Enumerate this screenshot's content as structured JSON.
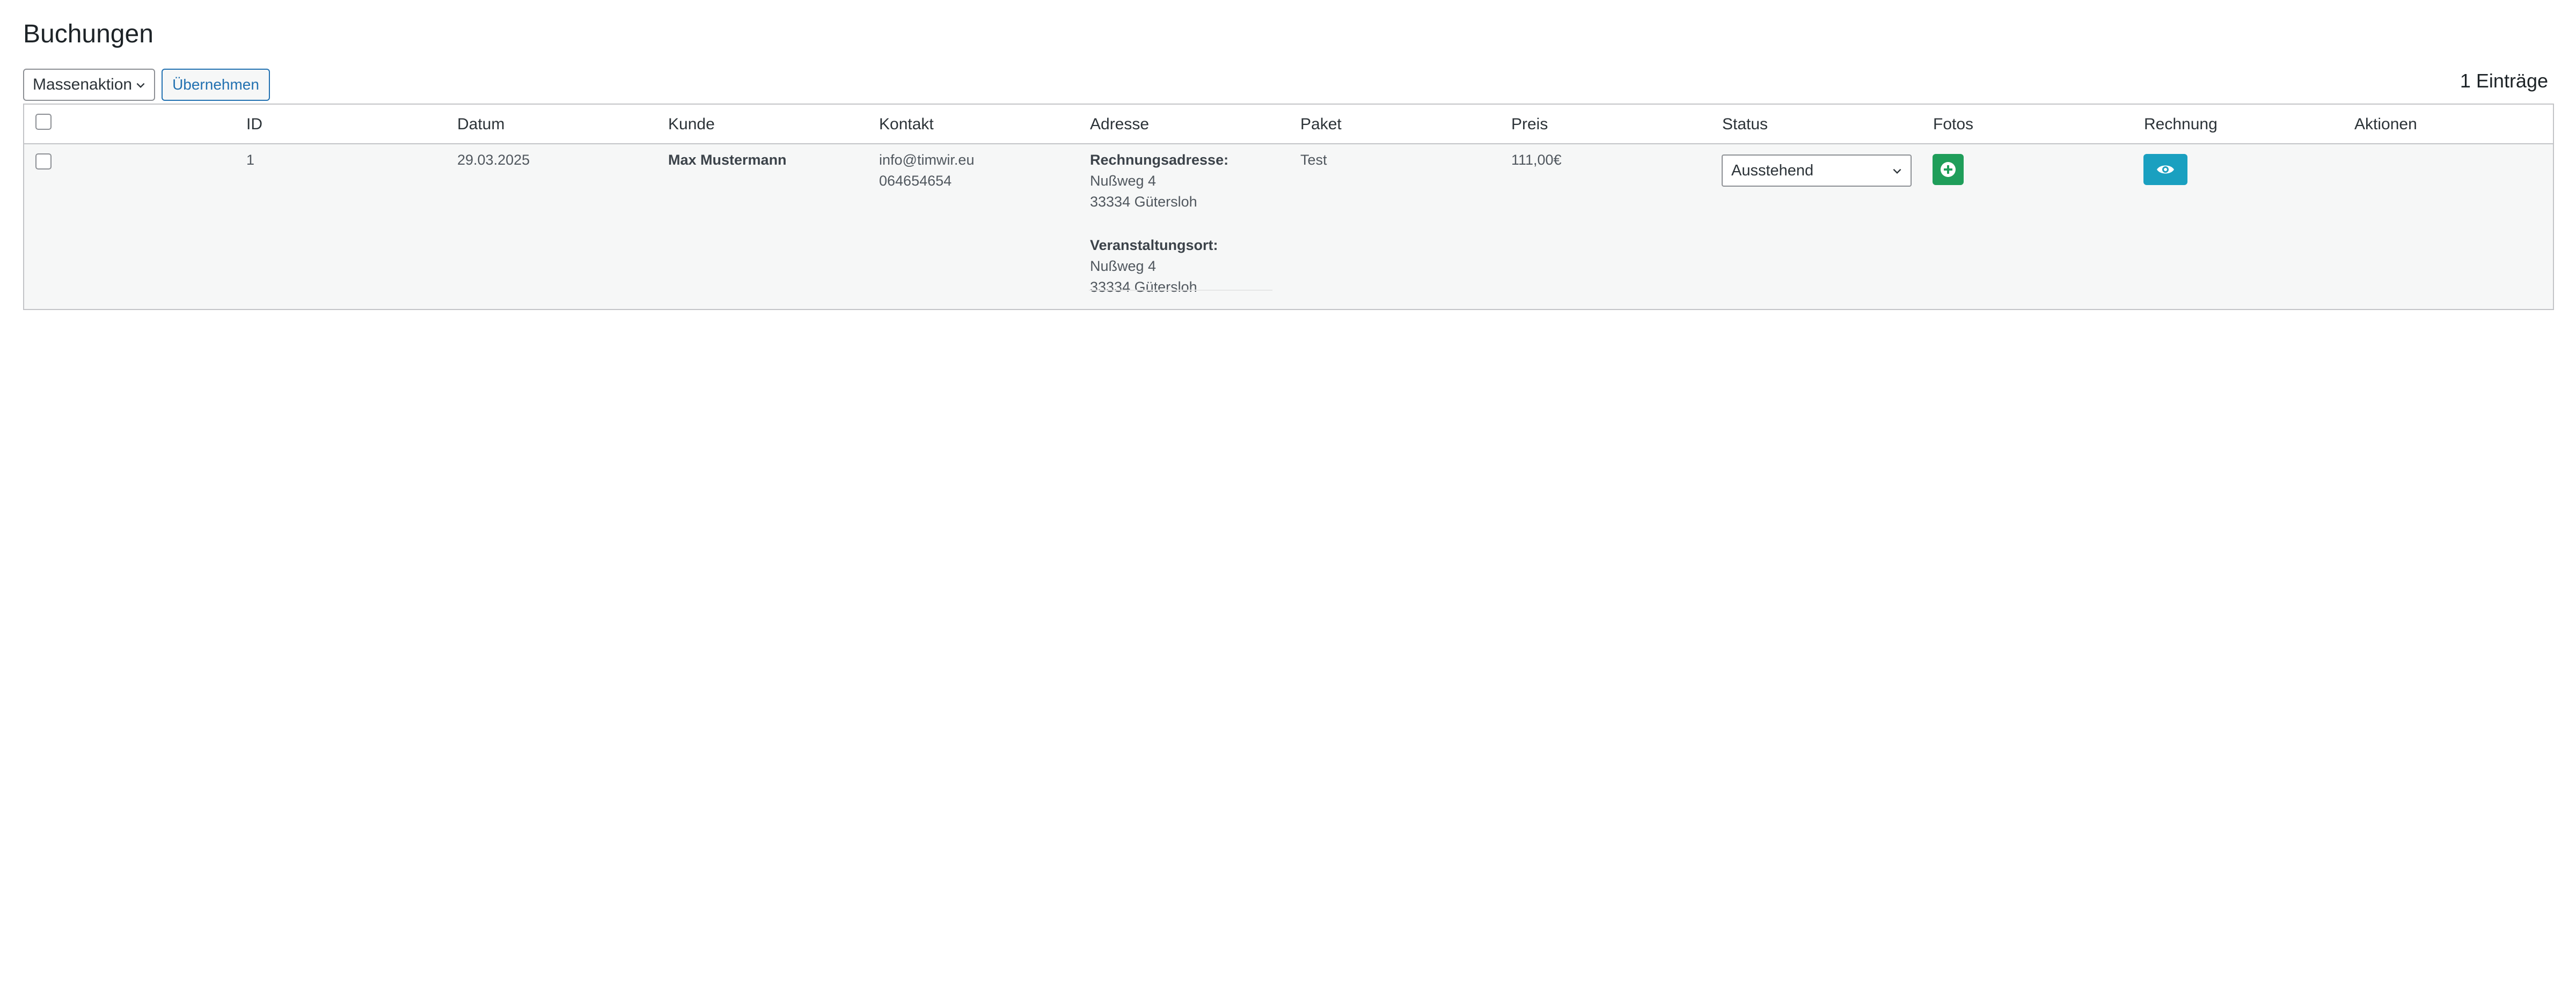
{
  "page": {
    "title": "Buchungen"
  },
  "toolbar": {
    "bulk_action_selected": "Massenaktion",
    "apply_label": "Übernehmen",
    "entries_count": "1 Einträge"
  },
  "table": {
    "headers": {
      "id": "ID",
      "date": "Datum",
      "customer": "Kunde",
      "contact": "Kontakt",
      "address": "Adresse",
      "package": "Paket",
      "price": "Preis",
      "status": "Status",
      "photos": "Fotos",
      "invoice": "Rechnung",
      "actions": "Aktionen"
    },
    "rows": [
      {
        "id": "1",
        "date": "29.03.2025",
        "customer": "Max Mustermann",
        "email": "info@timwir.eu",
        "phone": "064654654",
        "billing_label": "Rechnungsadresse:",
        "billing_street": "Nußweg 4",
        "billing_city": "33334 Gütersloh",
        "venue_label": "Veranstaltungsort:",
        "venue_street": "Nußweg 4",
        "venue_city": "33334 Gütersloh",
        "package": "Test",
        "price": "111,00€",
        "status_selected": "Ausstehend"
      }
    ]
  },
  "icons": {
    "photos_add": "plus-circle-icon",
    "invoice_view": "eye-icon"
  },
  "colors": {
    "primary_link": "#2271b1",
    "photos_button": "#1f9e5a",
    "invoice_button": "#1aa0c0"
  }
}
